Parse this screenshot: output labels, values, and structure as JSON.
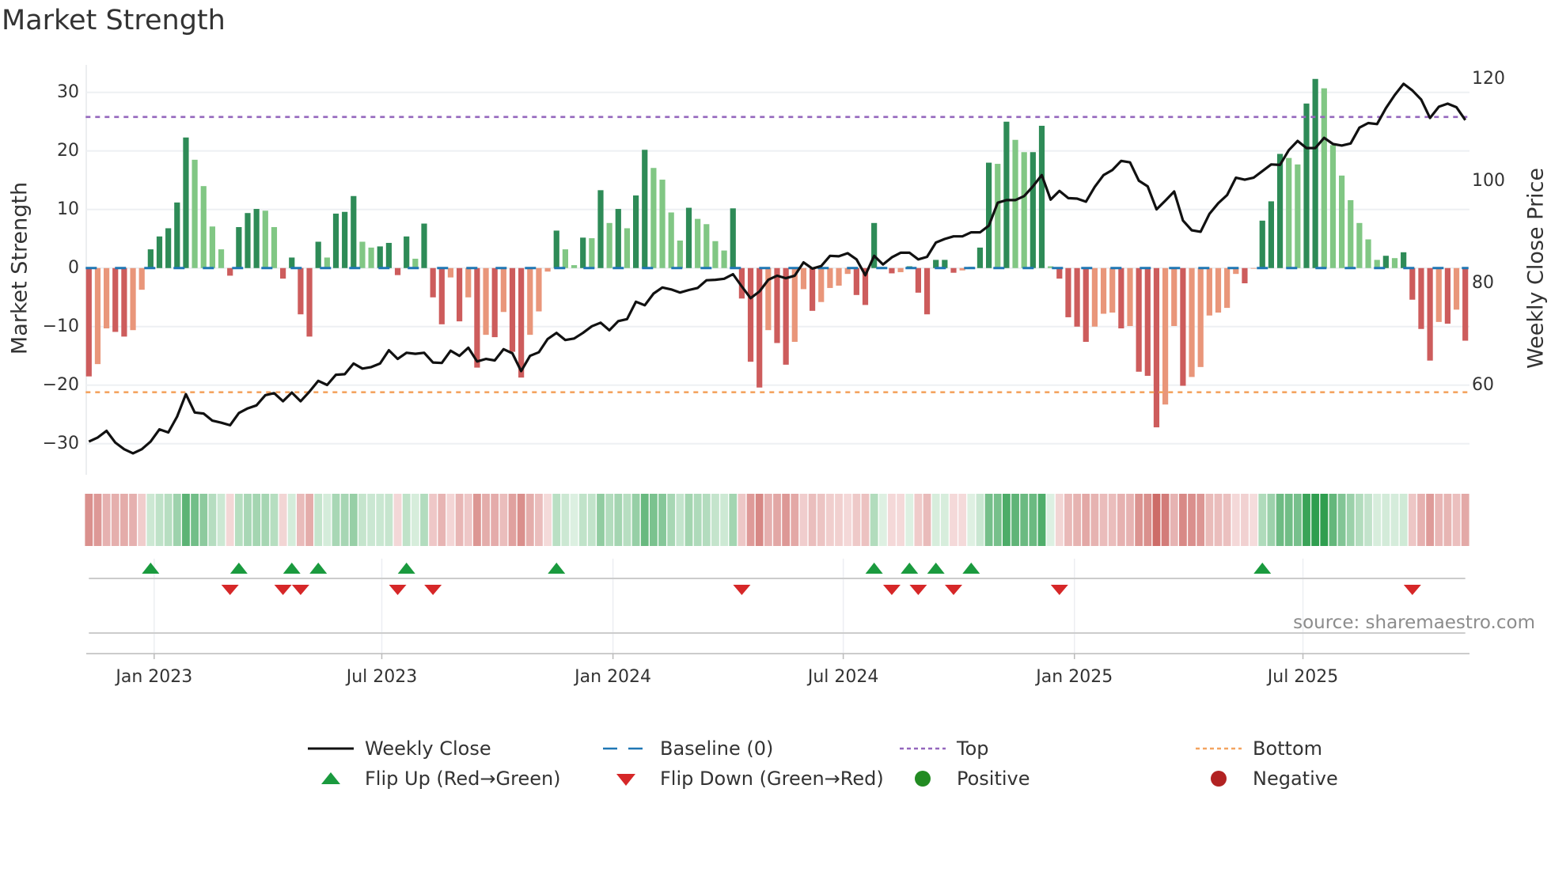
{
  "title": "Market Strength",
  "source": "source: sharemaestro.com",
  "legend": {
    "weekly_close": "Weekly Close",
    "baseline": "Baseline (0)",
    "top": "Top",
    "bottom": "Bottom",
    "flip_up": "Flip Up (Red→Green)",
    "flip_down": "Flip Down (Green→Red)",
    "positive": "Positive",
    "negative": "Negative"
  },
  "colors": {
    "green_strong": "#2e8b57",
    "green_soft": "#81c784",
    "red_strong": "#cd5c5c",
    "red_soft": "#e9967a",
    "close_line": "#111111",
    "baseline": "#1f77b4",
    "top": "#9467bd",
    "bottom": "#f4a460",
    "flip_up": "#1a9a3e",
    "flip_down": "#d62728",
    "positive": "#228b22",
    "negative": "#b22222"
  },
  "chart_data": {
    "type": "bar",
    "title": "Market Strength",
    "ylabel": "Market Strength",
    "y2label": "Weekly Close Price",
    "ylim": [
      -35.3,
      34.7
    ],
    "y2lim": [
      42.5,
      122.8
    ],
    "yticks": [
      "30",
      "20",
      "10",
      "0",
      "−10",
      "−20",
      "−30"
    ],
    "ytick_values": [
      30,
      20,
      10,
      0,
      -10,
      -20,
      -30
    ],
    "y2ticks": [
      "60",
      "80",
      "100",
      "120"
    ],
    "y2tick_values": [
      60,
      80,
      100,
      120
    ],
    "xticks": [
      {
        "label": "Jan 2023",
        "week": 7.4
      },
      {
        "label": "Jul 2023",
        "week": 33.2
      },
      {
        "label": "Jan 2024",
        "week": 59.4
      },
      {
        "label": "Jul 2024",
        "week": 85.5
      },
      {
        "label": "Jan 2025",
        "week": 111.7
      },
      {
        "label": "Jul 2025",
        "week": 137.6
      }
    ],
    "top_level": 25.8,
    "bottom_level": -21.2,
    "baseline": 0,
    "strength": [
      -18.5,
      -16.4,
      -10.3,
      -10.9,
      -11.7,
      -10.6,
      -3.7,
      3.2,
      5.4,
      6.8,
      11.2,
      22.3,
      18.5,
      14.0,
      7.1,
      3.2,
      -1.3,
      7.0,
      9.4,
      10.1,
      9.8,
      7.0,
      -1.8,
      1.8,
      -7.9,
      -11.7,
      4.5,
      1.8,
      9.3,
      9.6,
      12.3,
      4.5,
      3.5,
      3.7,
      4.3,
      -1.2,
      5.4,
      1.6,
      7.6,
      -5.0,
      -9.6,
      -1.6,
      -9.1,
      -5.0,
      -17.0,
      -11.4,
      -11.8,
      -7.5,
      -14.3,
      -18.7,
      -11.4,
      -7.4,
      -0.6,
      6.4,
      3.2,
      0.5,
      5.2,
      5.1,
      13.3,
      7.7,
      10.1,
      6.8,
      12.4,
      20.2,
      17.1,
      15.1,
      9.5,
      4.7,
      10.3,
      8.4,
      7.5,
      4.6,
      3.0,
      10.2,
      -5.2,
      -16.0,
      -20.4,
      -10.6,
      -12.8,
      -16.5,
      -12.6,
      -3.6,
      -7.3,
      -5.8,
      -3.4,
      -3.0,
      -1.0,
      -4.6,
      -6.3,
      7.7,
      0.2,
      -0.9,
      -0.7,
      0.3,
      -4.2,
      -7.9,
      1.4,
      1.4,
      -0.8,
      -0.4,
      0.2,
      3.5,
      18.0,
      17.8,
      25.0,
      21.9,
      19.8,
      19.8,
      24.3,
      0.3,
      -1.8,
      -8.4,
      -10.0,
      -12.6,
      -10.0,
      -7.8,
      -7.6,
      -10.3,
      -9.9,
      -17.7,
      -18.4,
      -27.2,
      -23.3,
      -9.9,
      -20.1,
      -18.6,
      -16.9,
      -8.1,
      -7.6,
      -6.8,
      -1.0,
      -2.6,
      -0.1,
      8.1,
      11.4,
      19.5,
      18.8,
      17.7,
      28.1,
      32.3,
      30.7,
      21.0,
      15.8,
      11.6,
      7.7,
      4.9,
      1.4,
      2.1,
      1.7,
      2.7,
      -5.4,
      -10.4,
      -15.8,
      -9.2,
      -9.5,
      -7.1,
      -12.4
    ],
    "weekly_close": [
      49.0,
      49.8,
      51.1,
      48.8,
      47.5,
      46.7,
      47.5,
      49.0,
      51.4,
      50.8,
      53.9,
      58.3,
      54.7,
      54.5,
      53.1,
      52.7,
      52.2,
      54.6,
      55.5,
      56.1,
      58.1,
      58.5,
      56.9,
      58.6,
      56.9,
      58.8,
      60.9,
      60.1,
      62.1,
      62.2,
      64.3,
      63.3,
      63.6,
      64.3,
      66.9,
      65.2,
      66.4,
      66.2,
      66.4,
      64.5,
      64.4,
      66.8,
      65.8,
      67.4,
      64.7,
      65.2,
      64.9,
      67.1,
      66.3,
      62.8,
      65.8,
      66.5,
      69.1,
      70.3,
      68.9,
      69.2,
      70.3,
      71.6,
      72.3,
      70.8,
      72.6,
      73.0,
      76.4,
      75.7,
      78.0,
      79.2,
      78.8,
      78.2,
      78.7,
      79.1,
      80.6,
      80.7,
      80.9,
      81.8,
      79.4,
      77.1,
      78.4,
      80.7,
      81.5,
      81.0,
      81.5,
      84.1,
      82.9,
      83.4,
      85.4,
      85.3,
      85.9,
      84.7,
      81.6,
      85.4,
      83.7,
      85.1,
      86.0,
      86.0,
      84.7,
      85.2,
      88.0,
      88.7,
      89.2,
      89.2,
      90.0,
      90.0,
      91.3,
      95.8,
      96.3,
      96.3,
      97.1,
      99.0,
      101.2,
      96.4,
      98.1,
      96.7,
      96.6,
      96.0,
      98.9,
      101.2,
      102.2,
      104.0,
      103.7,
      100.1,
      99.0,
      94.5,
      96.2,
      98.0,
      92.3,
      90.4,
      90.1,
      93.6,
      95.7,
      97.3,
      100.7,
      100.3,
      100.7,
      102.0,
      103.3,
      103.2,
      106.1,
      107.9,
      106.5,
      106.5,
      108.5,
      107.3,
      107.0,
      107.4,
      110.5,
      111.4,
      111.2,
      114.3,
      116.9,
      119.1,
      117.8,
      116.0,
      112.4,
      114.6,
      115.2,
      114.5,
      112.0
    ]
  }
}
